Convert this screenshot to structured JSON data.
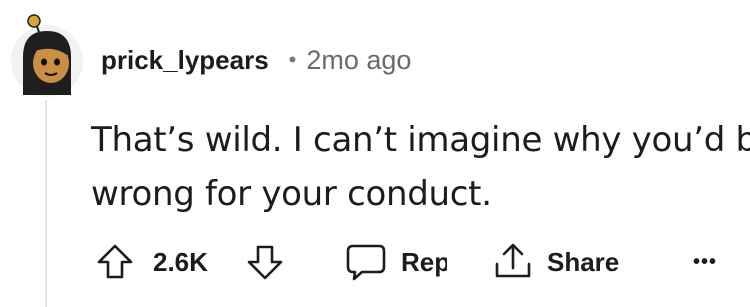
{
  "comment": {
    "username": "prick_lypears",
    "separator": "•",
    "time_ago": "2mo ago",
    "body_lines": [
      "That’s wild. I can’t imagine why you’d be",
      "wrong for your conduct."
    ]
  },
  "actions": {
    "vote_count": "2.6K",
    "reply_label": "Reply",
    "share_label": "Share",
    "more_label": "•••"
  },
  "icons": {
    "upvote": "arrow-up-icon",
    "downvote": "arrow-down-icon",
    "reply": "speech-bubble-icon",
    "share": "share-icon",
    "more": "ellipsis-icon"
  },
  "colors": {
    "text": "#1c1c1c",
    "muted": "#6a6a6a",
    "avatar_bg": "#f2f2f2",
    "thread_line": "#e5e8ea"
  }
}
